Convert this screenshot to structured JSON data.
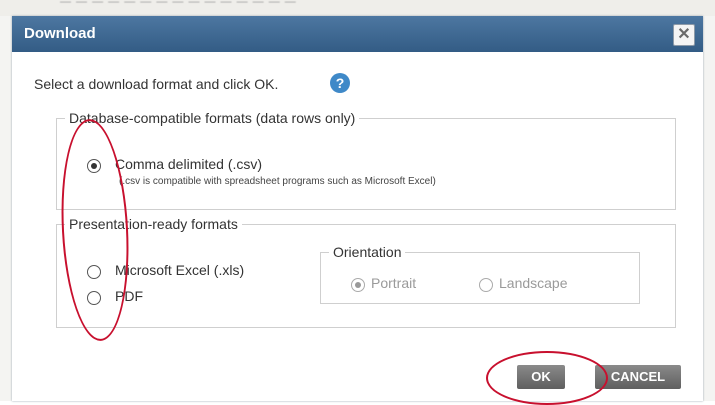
{
  "background": {
    "blurred_text": "— — — — — — — — — — — — — — —"
  },
  "dialog": {
    "title": "Download",
    "close_icon": "close-icon",
    "instruction": "Select a download format and click OK.",
    "help_icon": "?",
    "database_group": {
      "legend": "Database-compatible formats (data rows only)",
      "options": [
        {
          "label": "Comma delimited (.csv)",
          "checked": true,
          "note": "(.csv is compatible with spreadsheet programs such as Microsoft Excel)"
        }
      ]
    },
    "presentation_group": {
      "legend": "Presentation-ready formats",
      "options": [
        {
          "label": "Microsoft Excel (.xls)",
          "checked": false
        },
        {
          "label": "PDF",
          "checked": false
        }
      ],
      "orientation": {
        "legend": "Orientation",
        "disabled": true,
        "options": [
          {
            "label": "Portrait",
            "checked": true
          },
          {
            "label": "Landscape",
            "checked": false
          }
        ]
      }
    },
    "buttons": {
      "ok": "OK",
      "cancel": "CANCEL"
    },
    "colors": {
      "titlebar": "#3f6892",
      "button": "#6e6e6e",
      "annotation": "#c8102e",
      "help": "#3f89c8"
    }
  }
}
